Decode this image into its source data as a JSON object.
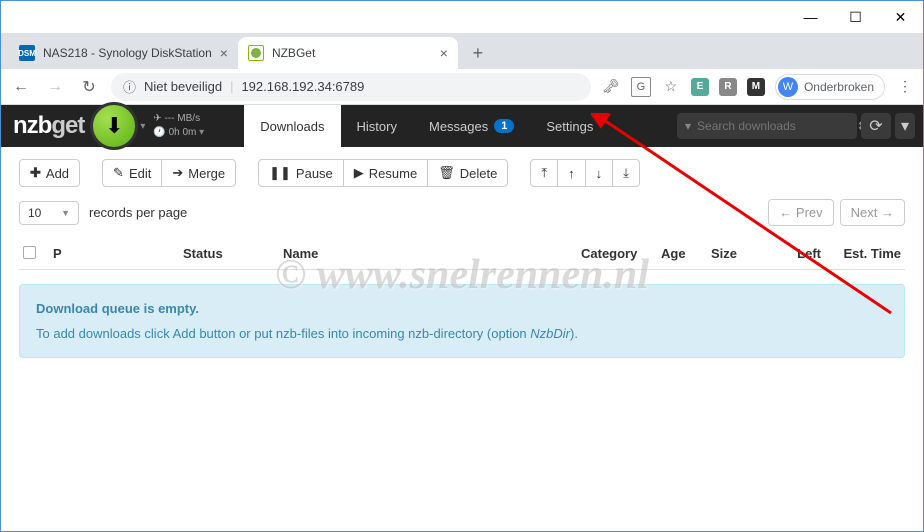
{
  "browser": {
    "tabs": [
      {
        "title": "NAS218 - Synology DiskStation",
        "favicon": "DSM"
      },
      {
        "title": "NZBGet",
        "favicon": "nzb"
      }
    ],
    "active_tab": 1,
    "nav": {
      "back": "←",
      "forward": "→",
      "reload": "↻"
    },
    "security_text": "Niet beveiligd",
    "url": "192.168.192.34:6789",
    "profile_letter": "W",
    "profile_label": "Onderbroken",
    "window_controls": {
      "min": "—",
      "max": "☐",
      "close": "✕"
    }
  },
  "header": {
    "logo_nzb": "nzb",
    "logo_get": "get",
    "speed": "--- MB/s",
    "time": "0h 0m",
    "tabs": {
      "downloads": "Downloads",
      "history": "History",
      "messages": "Messages",
      "messages_badge": "1",
      "settings": "Settings"
    },
    "search_placeholder": "Search downloads"
  },
  "toolbar": {
    "add": "Add",
    "edit": "Edit",
    "merge": "Merge",
    "pause": "Pause",
    "resume": "Resume",
    "delete": "Delete"
  },
  "pager": {
    "records_value": "10",
    "records_label": "records per page",
    "prev": "← Prev",
    "next": "Next →"
  },
  "columns": {
    "p": "P",
    "status": "Status",
    "name": "Name",
    "category": "Category",
    "age": "Age",
    "size": "Size",
    "left": "Left",
    "est": "Est. Time"
  },
  "empty": {
    "title": "Download queue is empty.",
    "body_pre": "To add downloads click Add button or put nzb-files into incoming nzb-directory (option ",
    "body_em": "NzbDir",
    "body_post": ")."
  },
  "watermark": "© www.snelrennen.nl"
}
